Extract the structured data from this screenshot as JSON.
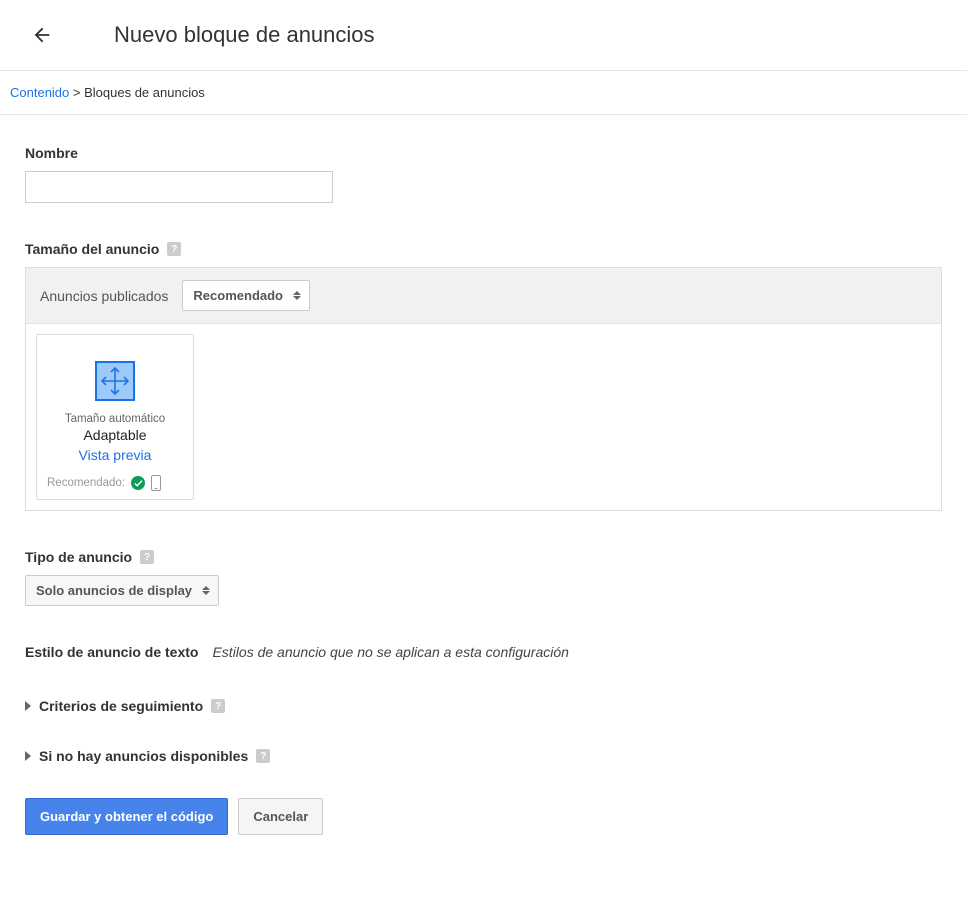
{
  "header": {
    "title": "Nuevo bloque de anuncios"
  },
  "breadcrumb": {
    "root": "Contenido",
    "sep": " > ",
    "current": "Bloques de anuncios"
  },
  "nameField": {
    "label": "Nombre",
    "value": ""
  },
  "adSize": {
    "label": "Tamaño del anuncio",
    "headerLabel": "Anuncios publicados",
    "selectValue": "Recomendado",
    "card": {
      "small": "Tamaño automático",
      "main": "Adaptable",
      "previewLink": "Vista previa",
      "recLabel": "Recomendado:"
    }
  },
  "adType": {
    "label": "Tipo de anuncio",
    "selectValue": "Solo anuncios de display"
  },
  "textAdStyle": {
    "label": "Estilo de anuncio de texto",
    "note": "Estilos de anuncio que no se aplican a esta configuración"
  },
  "expanders": {
    "tracking": "Criterios de seguimiento",
    "noAds": "Si no hay anuncios disponibles"
  },
  "actions": {
    "save": "Guardar y obtener el código",
    "cancel": "Cancelar"
  },
  "helpGlyph": "?"
}
